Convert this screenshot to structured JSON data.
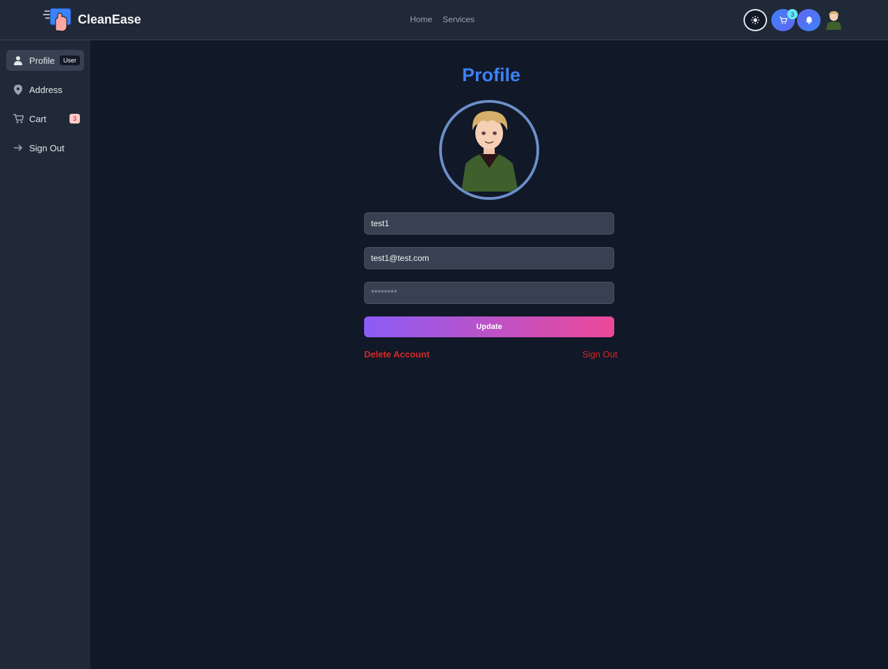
{
  "brand": {
    "name": "CleanEase"
  },
  "nav": {
    "home": "Home",
    "services": "Services"
  },
  "header": {
    "cart_count": "3",
    "icons": [
      "theme-toggle-icon",
      "cart-icon",
      "bell-icon"
    ]
  },
  "sidebar": {
    "items": [
      {
        "label": "Profile",
        "badge": "User",
        "icon": "user-icon"
      },
      {
        "label": "Address",
        "icon": "location-pin-icon"
      },
      {
        "label": "Cart",
        "badge": "3",
        "icon": "cart-icon"
      },
      {
        "label": "Sign Out",
        "icon": "arrow-right-icon"
      }
    ]
  },
  "profile": {
    "title": "Profile",
    "username_value": "test1",
    "email_value": "test1@test.com",
    "password_placeholder": "********",
    "update_label": "Update",
    "delete_label": "Delete Account",
    "signout_label": "Sign Out"
  },
  "colors": {
    "accent": "#3b82f6",
    "danger": "#dc2626",
    "gradient_start": "#8b5cf6",
    "gradient_end": "#ec4899"
  }
}
